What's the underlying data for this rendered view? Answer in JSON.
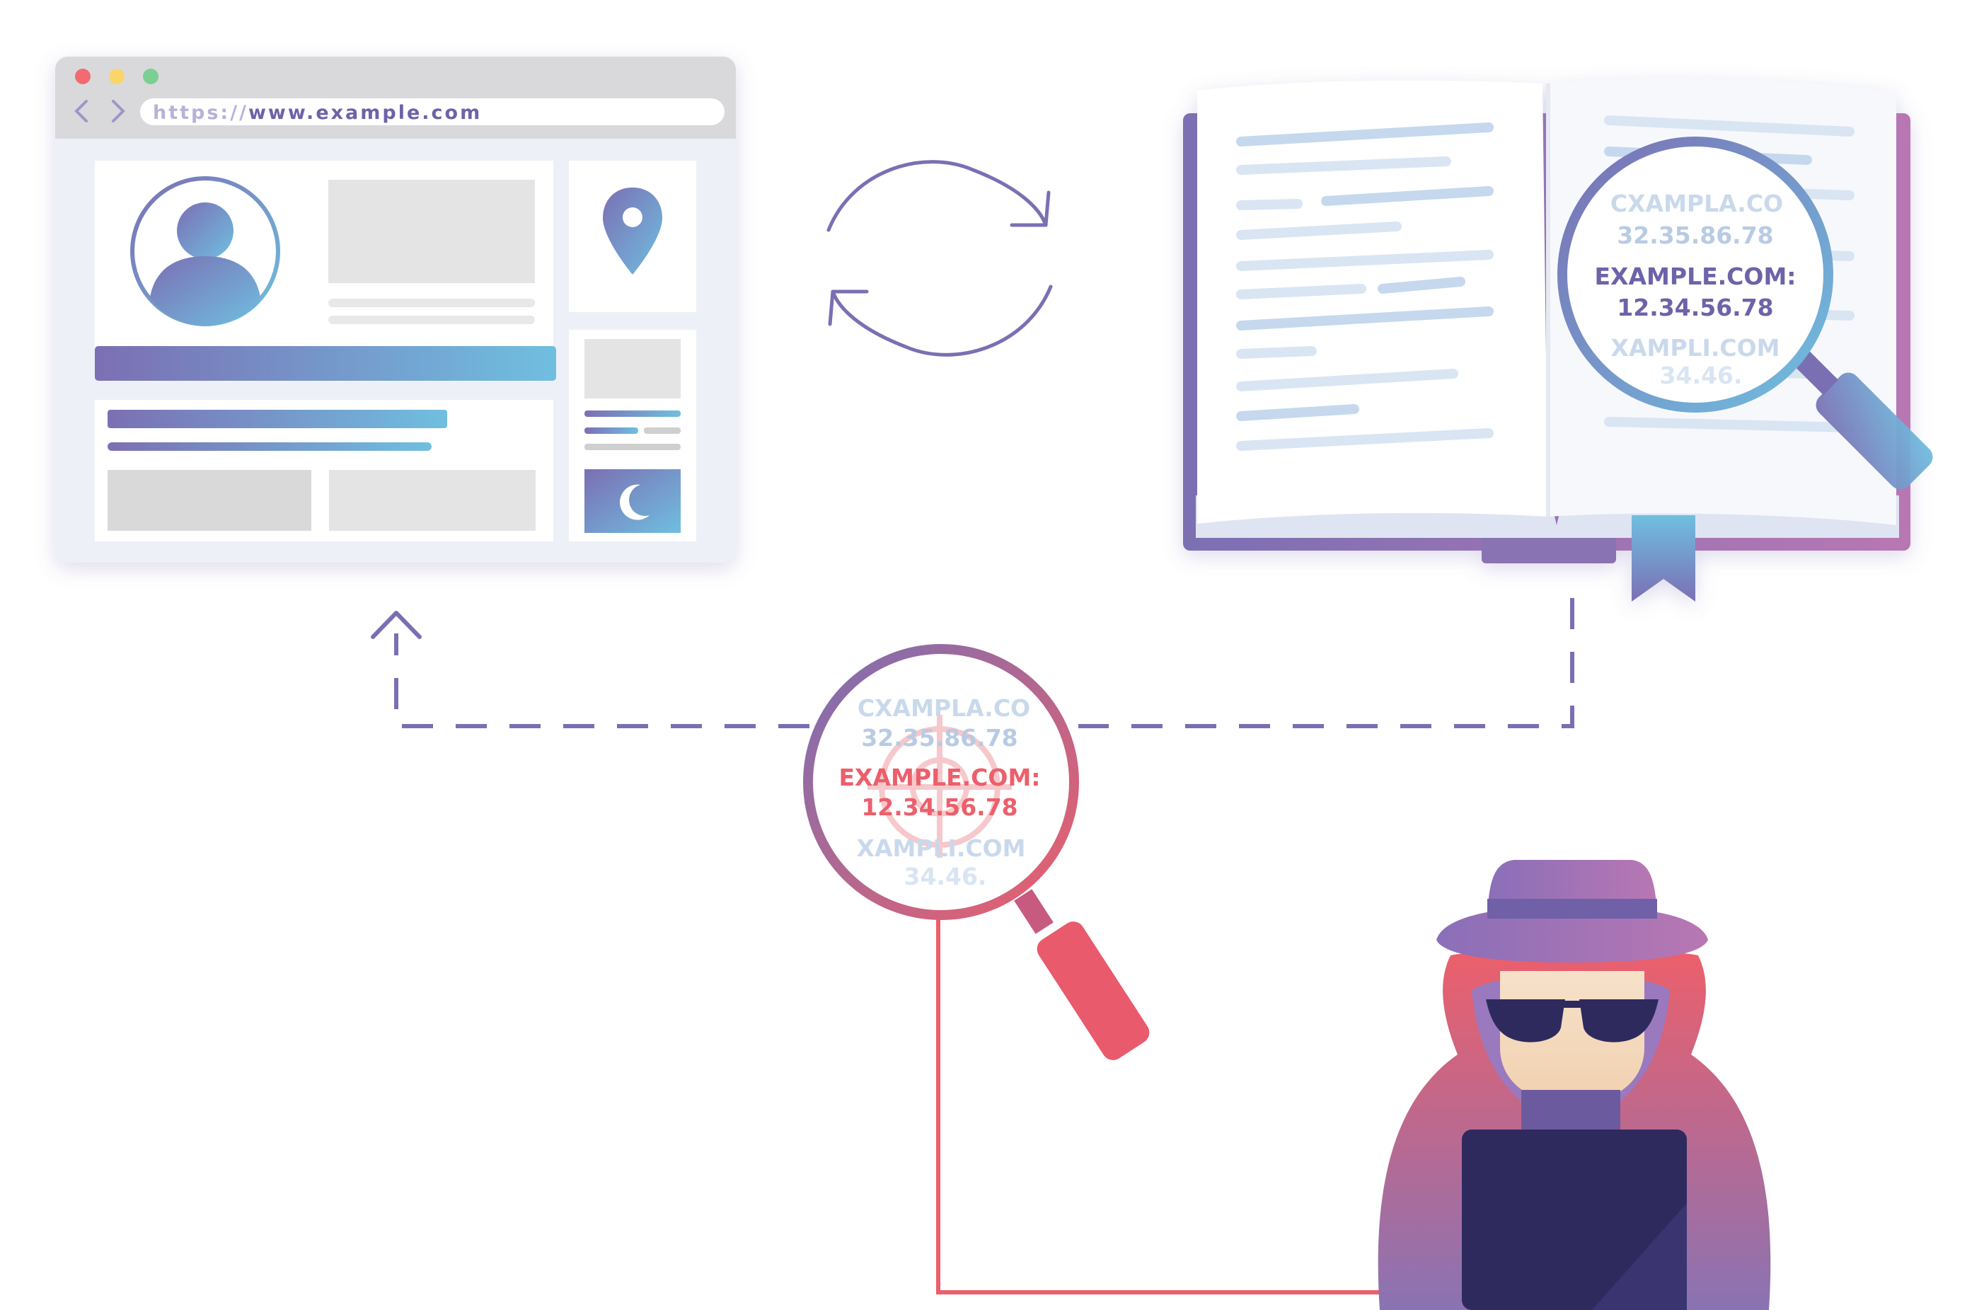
{
  "browser": {
    "url": {
      "scheme": "https://",
      "host": "www.example.com"
    }
  },
  "book_lens": {
    "lines": [
      "CXAMPLA.CO",
      "32.35.86.78",
      "EXAMPLE.COM:",
      "12.34.56.78",
      "XAMPLI.COM",
      "34.46."
    ]
  },
  "spy_lens": {
    "lines": [
      "CXAMPLA.CO",
      "32.35.86.78",
      "EXAMPLE.COM:",
      "12.34.56.78",
      "XAMPLI.COM",
      "34.46."
    ]
  },
  "colors": {
    "purple": "#7b6fb3",
    "blue": "#6fbfe0",
    "red": "#ec5f6b",
    "magenta": "#b877b3",
    "navy": "#2e2a5e",
    "faint_blue": "#c9d9ec",
    "grey_placeholder": "#e4e4e4"
  },
  "icons": {
    "browser_close": "close-dot-icon",
    "browser_minimize": "minimize-dot-icon",
    "browser_maximize": "maximize-dot-icon",
    "nav_back": "chevron-left-icon",
    "nav_forward": "chevron-right-icon",
    "profile": "user-avatar-icon",
    "location": "map-pin-icon",
    "night_mode": "crescent-moon-icon",
    "sync": "refresh-cycle-icon",
    "search": "magnifying-glass-icon",
    "target": "crosshair-target-icon",
    "attacker": "hacker-spy-icon",
    "book": "open-book-icon",
    "bookmark": "bookmark-ribbon-icon"
  }
}
